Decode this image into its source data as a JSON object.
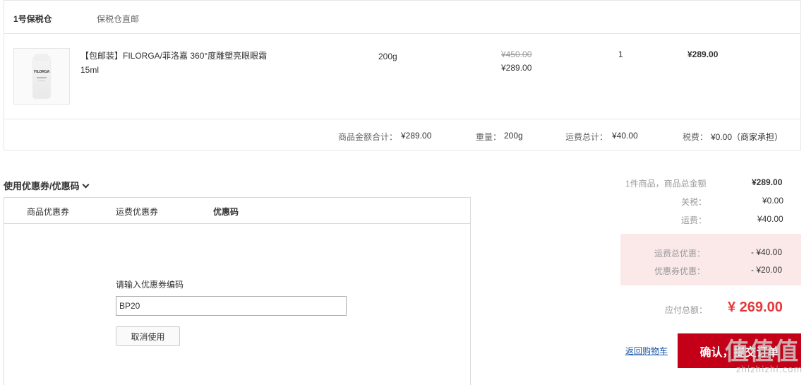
{
  "warehouse": {
    "name": "1号保税仓",
    "tag": "保税仓直邮"
  },
  "product": {
    "name": "【包邮装】FILORGA/菲洛嘉 360°度雕塑亮眼眼霜15ml",
    "thumb_logo": "FILORGA",
    "spec": "200g",
    "original_price": "¥450.00",
    "price": "¥289.00",
    "quantity": "1",
    "subtotal": "¥289.00"
  },
  "order_summary": {
    "goods_total_label": "商品金额合计：",
    "goods_total_value": "¥289.00",
    "weight_label": "重量：",
    "weight_value": "200g",
    "shipping_label": "运费总计：",
    "shipping_value": "¥40.00",
    "tax_label": "税费：",
    "tax_value": "¥0.00（商家承担）"
  },
  "coupon": {
    "title": "使用优惠券/优惠码",
    "tabs": [
      {
        "label": "商品优惠券"
      },
      {
        "label": "运费优惠券"
      },
      {
        "label": "优惠码"
      }
    ],
    "active_tab": "优惠码",
    "code_label": "请输入优惠券编码",
    "code_value": "BP20",
    "cancel_label": "取消使用"
  },
  "totals": {
    "items_label": "1件商品，商品总金额",
    "items_value": "¥289.00",
    "tariff_label": "关税：",
    "tariff_value": "¥0.00",
    "shipping_label": "运费：",
    "shipping_value": "¥40.00",
    "shipping_discount_label": "运费总优惠：",
    "shipping_discount_value": "- ¥40.00",
    "coupon_discount_label": "优惠券优惠：",
    "coupon_discount_value": "- ¥20.00",
    "due_label": "应付总额：",
    "due_value": "¥ 269.00"
  },
  "actions": {
    "back_label": "返回购物车",
    "submit_label": "确认，提交订单"
  },
  "watermark": {
    "big": "值值值",
    "small": "zhizhizhi.com"
  },
  "colors": {
    "accent_red": "#c40018",
    "price_red": "#e4393c",
    "discount_bg": "#fbe9e9",
    "link_blue": "#1a56a8"
  }
}
